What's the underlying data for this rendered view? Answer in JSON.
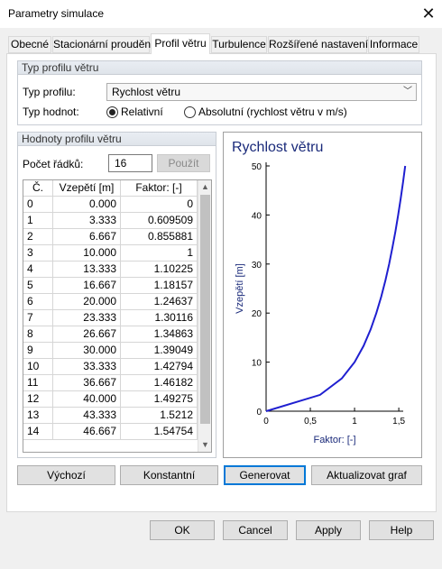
{
  "window": {
    "title": "Parametry simulace"
  },
  "tabs": [
    {
      "label": "Obecné",
      "active": false
    },
    {
      "label": "Stacionární proudění",
      "active": false
    },
    {
      "label": "Profil větru",
      "active": true
    },
    {
      "label": "Turbulence",
      "active": false
    },
    {
      "label": "Rozšířené nastavení",
      "active": false
    },
    {
      "label": "Informace",
      "active": false
    }
  ],
  "profile_type_group": {
    "title": "Typ profilu větru",
    "type_label": "Typ profilu:",
    "type_value": "Rychlost větru",
    "values_label": "Typ hodnot:",
    "relative_label": "Relativní",
    "absolute_label": "Absolutní (rychlost větru v m/s)",
    "selected": "relative"
  },
  "values_group": {
    "title": "Hodnoty profilu větru",
    "rows_label": "Počet řádků:",
    "rows_value": "16",
    "apply_label": "Použít"
  },
  "table": {
    "columns": [
      "Č.",
      "Vzepětí [m]",
      "Faktor: [-]"
    ],
    "rows": [
      [
        "0",
        "0.000",
        "0"
      ],
      [
        "1",
        "3.333",
        "0.609509"
      ],
      [
        "2",
        "6.667",
        "0.855881"
      ],
      [
        "3",
        "10.000",
        "1"
      ],
      [
        "4",
        "13.333",
        "1.10225"
      ],
      [
        "5",
        "16.667",
        "1.18157"
      ],
      [
        "6",
        "20.000",
        "1.24637"
      ],
      [
        "7",
        "23.333",
        "1.30116"
      ],
      [
        "8",
        "26.667",
        "1.34863"
      ],
      [
        "9",
        "30.000",
        "1.39049"
      ],
      [
        "10",
        "33.333",
        "1.42794"
      ],
      [
        "11",
        "36.667",
        "1.46182"
      ],
      [
        "12",
        "40.000",
        "1.49275"
      ],
      [
        "13",
        "43.333",
        "1.5212"
      ],
      [
        "14",
        "46.667",
        "1.54754"
      ]
    ]
  },
  "chart_data": {
    "type": "line",
    "title": "Rychlost větru",
    "xlabel": "Faktor: [-]",
    "ylabel": "Vzepětí [m]",
    "xlim": [
      0,
      1.55
    ],
    "ylim": [
      0,
      50
    ],
    "xticks": [
      "0",
      "0,5",
      "1",
      "1,5"
    ],
    "xtick_values": [
      0,
      0.5,
      1,
      1.5
    ],
    "yticks": [
      "0",
      "10",
      "20",
      "30",
      "40",
      "50"
    ],
    "ytick_values": [
      0,
      10,
      20,
      30,
      40,
      50
    ],
    "grid": false,
    "line_color": "#1f1fd0",
    "title_color": "#1a2a7a",
    "series": [
      {
        "x": [
          0,
          0.609509,
          0.855881,
          1,
          1.10225,
          1.18157,
          1.24637,
          1.30116,
          1.34863,
          1.39049,
          1.42794,
          1.46182,
          1.49275,
          1.5212,
          1.54754,
          1.5722
        ],
        "y": [
          0,
          3.333,
          6.667,
          10,
          13.333,
          16.667,
          20,
          23.333,
          26.667,
          30,
          33.333,
          36.667,
          40,
          43.333,
          46.667,
          50
        ]
      }
    ]
  },
  "action_buttons": {
    "default_label": "Výchozí",
    "constant_label": "Konstantní",
    "generate_label": "Generovat",
    "update_label": "Aktualizovat graf"
  },
  "dialog_buttons": {
    "ok": "OK",
    "cancel": "Cancel",
    "apply": "Apply",
    "help": "Help"
  }
}
